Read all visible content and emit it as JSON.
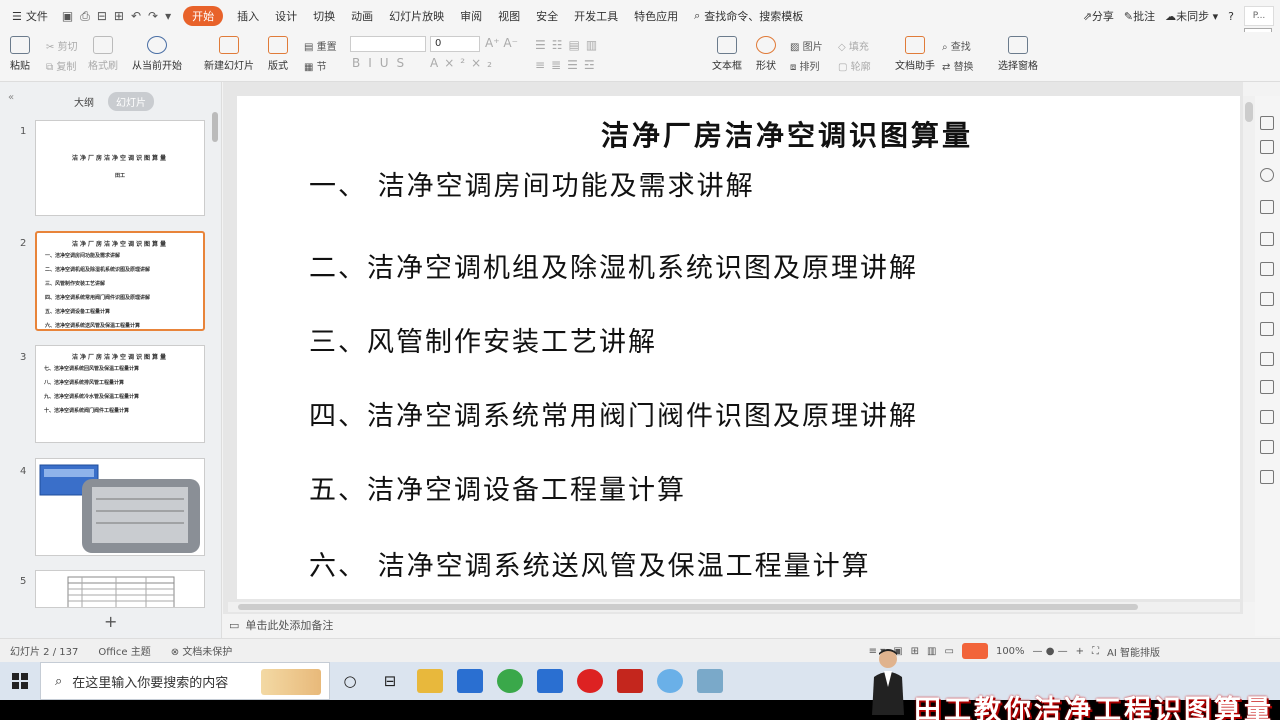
{
  "menubar": {
    "file_label": "文件",
    "tabs": [
      "开始",
      "插入",
      "设计",
      "切换",
      "动画",
      "幻灯片放映",
      "审阅",
      "视图",
      "安全",
      "开发工具",
      "特色应用"
    ],
    "active_tab": "开始",
    "search_placeholder": "查找命令、搜索模板",
    "share": "分享",
    "comment": "批注",
    "sync": "未同步",
    "user_mini": "P...",
    "tooltip": "开始"
  },
  "ribbon": {
    "paste": "粘贴",
    "cut": "剪切",
    "copy": "复制",
    "format_painter": "格式刷",
    "from_current": "从当前开始",
    "new_slide": "新建幻灯片",
    "layout": "版式",
    "reset": "重置",
    "section": "节",
    "font_size": "0",
    "textbox": "文本框",
    "shape": "形状",
    "picture": "图片",
    "fill": "填充",
    "arrange": "排列",
    "outline": "轮廓",
    "doc_assistant": "文档助手",
    "find": "查找",
    "replace": "替换",
    "selection_pane": "选择窗格"
  },
  "leftpanel": {
    "tab_outline": "大纲",
    "tab_slides": "幻灯片",
    "slides": [
      {
        "num": "1",
        "title": "洁净厂房洁净空调识图算量",
        "lines": [
          "田工"
        ]
      },
      {
        "num": "2",
        "title": "洁净厂房洁净空调识图算量",
        "lines": [
          "一、洁净空调房间功能及需求讲解",
          "二、洁净空调机组及除湿机系统识图及原理讲解",
          "三、风管制作安装工艺讲解",
          "四、洁净空调系统常用阀门阀件识图及原理讲解",
          "五、洁净空调设备工程量计算",
          "六、洁净空调系统送风管及保温工程量计算"
        ]
      },
      {
        "num": "3",
        "title": "洁净厂房洁净空调识图算量",
        "lines": [
          "七、洁净空调系统回风管及保温工程量计算",
          "八、洁净空调系统排风管工程量计算",
          "九、洁净空调系统冷水管及保温工程量计算",
          "十、洁净空调系统阀门阀件工程量计算"
        ]
      },
      {
        "num": "4"
      },
      {
        "num": "5"
      }
    ]
  },
  "slide": {
    "title": "洁净厂房洁净空调识图算量",
    "items": [
      "一、 洁净空调房间功能及需求讲解",
      "二、洁净空调机组及除湿机系统识图及原理讲解",
      "三、风管制作安装工艺讲解",
      "四、洁净空调系统常用阀门阀件识图及原理讲解",
      "五、洁净空调设备工程量计算",
      "六、 洁净空调系统送风管及保温工程量计算"
    ]
  },
  "notes_placeholder": "单击此处添加备注",
  "status": {
    "slide_count": "幻灯片 2 / 137",
    "theme": "Office 主题",
    "protect": "文档未保护",
    "zoom": "100%",
    "ai": "AI 智能排版"
  },
  "taskbar": {
    "search_placeholder": "在这里输入你要搜索的内容"
  },
  "banner": {
    "text": "田工教你洁净工程识图算量"
  },
  "colors": {
    "accent": "#e8622a",
    "selected_border": "#e8843a"
  }
}
